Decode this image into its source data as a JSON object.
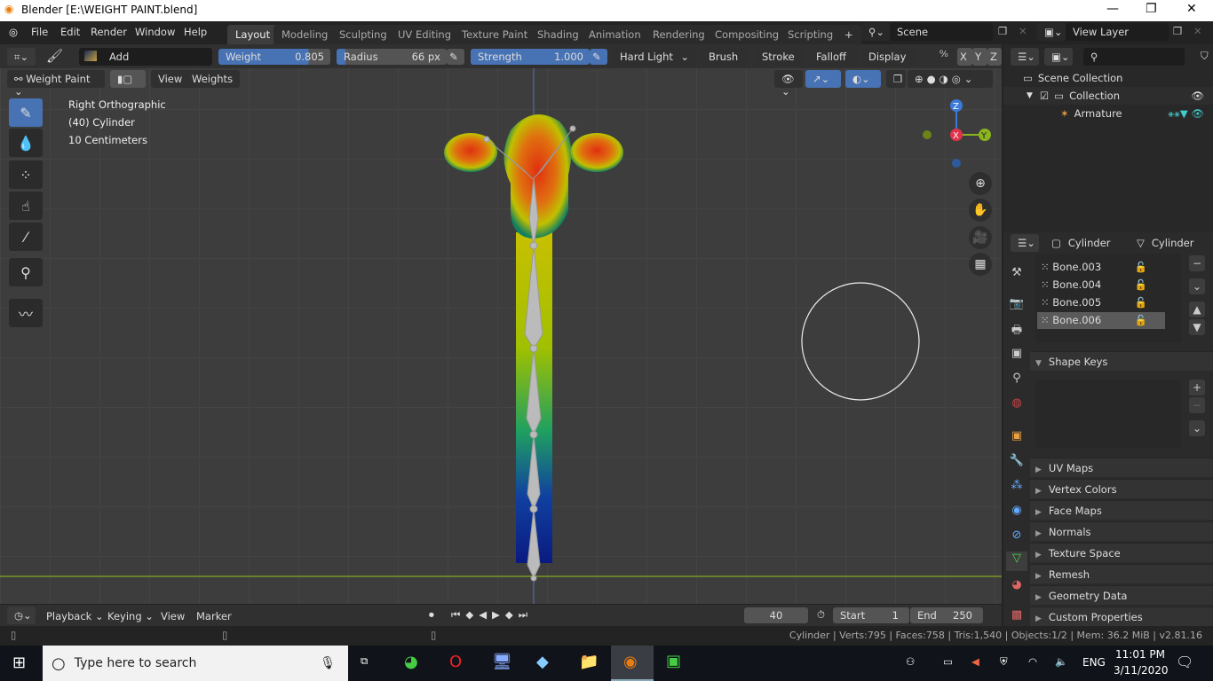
{
  "window": {
    "title": "Blender [E:\\WEIGHT PAINT.blend]"
  },
  "menu": [
    "File",
    "Edit",
    "Render",
    "Window",
    "Help"
  ],
  "workspaces": [
    "Layout",
    "Modeling",
    "Sculpting",
    "UV Editing",
    "Texture Paint",
    "Shading",
    "Animation",
    "Rendering",
    "Compositing",
    "Scripting"
  ],
  "add_workspace": "+",
  "scene": "Scene",
  "view_layer": "View Layer",
  "tool_header": {
    "blend": "Add",
    "weight_label": "Weight",
    "weight": "0.805",
    "weight_fraction": 0.805,
    "radius_label": "Radius",
    "radius": "66 px",
    "strength_label": "Strength",
    "strength": "1.000",
    "blend_mode": "Hard Light",
    "brush": "Brush",
    "stroke": "Stroke",
    "falloff": "Falloff",
    "display": "Display",
    "axes": [
      "X",
      "Y",
      "Z"
    ]
  },
  "viewport_header": {
    "mode": "Weight Paint",
    "view": "View",
    "weights": "Weights"
  },
  "overlay": {
    "view_name": "Right Orthographic",
    "object": "(40) Cylinder",
    "scale": "10 Centimeters"
  },
  "gizmo": {
    "z": "Z",
    "x": "X",
    "y": "Y"
  },
  "outliner": {
    "root": "Scene Collection",
    "collection": "Collection",
    "armature": "Armature"
  },
  "properties": {
    "object": "Cylinder",
    "data": "Cylinder",
    "bones": [
      "Bone.003",
      "Bone.004",
      "Bone.005",
      "Bone.006"
    ],
    "panels": [
      "Shape Keys",
      "UV Maps",
      "Vertex Colors",
      "Face Maps",
      "Normals",
      "Texture Space",
      "Remesh",
      "Geometry Data",
      "Custom Properties"
    ]
  },
  "timeline": {
    "playback": "Playback",
    "keying": "Keying",
    "view": "View",
    "marker": "Marker",
    "frame": "40",
    "start_label": "Start",
    "start": "1",
    "end_label": "End",
    "end": "250"
  },
  "status": "Cylinder | Verts:795 | Faces:758 | Tris:1,540 | Objects:1/2 | Mem: 36.2 MiB | v2.81.16",
  "taskbar": {
    "search": "Type here to search",
    "lang": "ENG",
    "time": "11:01 PM",
    "date": "3/11/2020"
  }
}
